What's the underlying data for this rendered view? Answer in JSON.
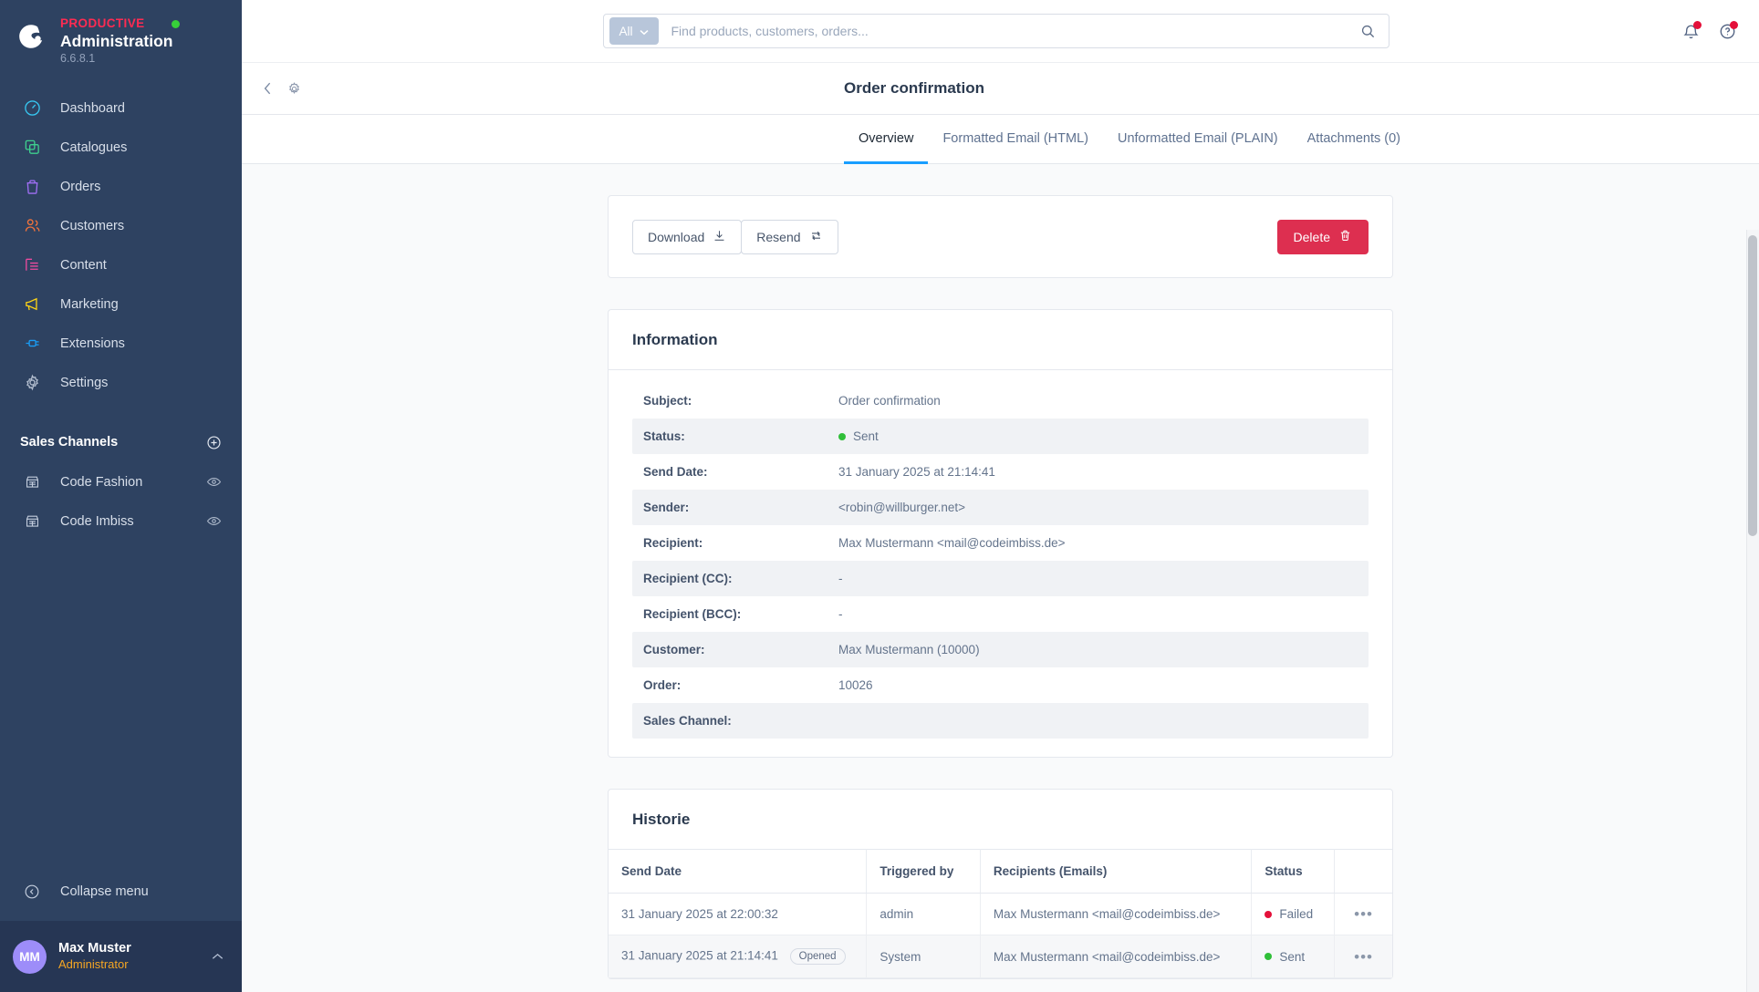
{
  "sidebar": {
    "brand": {
      "product": "PRODUCTIVE",
      "title": "Administration",
      "version": "6.6.8.1",
      "logo_icon": "shopware-logo-icon",
      "status_icon": "online-status-dot"
    },
    "items": [
      {
        "label": "Dashboard",
        "icon": "dashboard-icon",
        "color": "#37c6f0"
      },
      {
        "label": "Catalogues",
        "icon": "catalogues-icon",
        "color": "#3ecf8e"
      },
      {
        "label": "Orders",
        "icon": "orders-icon",
        "color": "#a06ff5"
      },
      {
        "label": "Customers",
        "icon": "customers-icon",
        "color": "#f2733b"
      },
      {
        "label": "Content",
        "icon": "content-icon",
        "color": "#ef4ba0"
      },
      {
        "label": "Marketing",
        "icon": "marketing-icon",
        "color": "#fbd216"
      },
      {
        "label": "Extensions",
        "icon": "extensions-icon",
        "color": "#1a9df5"
      },
      {
        "label": "Settings",
        "icon": "settings-gear-icon",
        "color": "#b4bfd0"
      }
    ],
    "sales_channels": {
      "title": "Sales Channels",
      "add_icon": "plus-circle-icon",
      "channels": [
        {
          "label": "Code Fashion",
          "icon": "storefront-icon",
          "visibility_icon": "eye-icon"
        },
        {
          "label": "Code Imbiss",
          "icon": "storefront-icon",
          "visibility_icon": "eye-icon"
        }
      ]
    },
    "collapse": {
      "label": "Collapse menu",
      "icon": "collapse-chevron-icon"
    },
    "user": {
      "initials": "MM",
      "name": "Max Muster",
      "role": "Administrator",
      "caret_icon": "chevron-up-icon"
    }
  },
  "topbar": {
    "scope_label": "All",
    "scope_caret_icon": "chevron-down-icon",
    "search_value": "",
    "search_placeholder": "Find products, customers, orders...",
    "search_icon": "search-icon",
    "notifications_icon": "bell-icon",
    "help_icon": "help-circle-icon"
  },
  "page": {
    "back_icon": "chevron-left-icon",
    "settings_icon": "gear-icon",
    "title": "Order confirmation"
  },
  "tabs": [
    {
      "label": "Overview",
      "active": true
    },
    {
      "label": "Formatted Email (HTML)",
      "active": false
    },
    {
      "label": "Unformatted Email (PLAIN)",
      "active": false
    },
    {
      "label": "Attachments (0)",
      "active": false
    }
  ],
  "actions": {
    "download": {
      "label": "Download",
      "icon": "download-icon"
    },
    "resend": {
      "label": "Resend",
      "icon": "refresh-icon"
    },
    "delete": {
      "label": "Delete",
      "icon": "trash-icon",
      "color": "#dd2f50"
    }
  },
  "information": {
    "title": "Information",
    "rows": [
      {
        "key": "Subject:",
        "value": "Order confirmation",
        "dot": null
      },
      {
        "key": "Status:",
        "value": "Sent",
        "dot": "#30bf39"
      },
      {
        "key": "Send Date:",
        "value": "31 January 2025 at 21:14:41",
        "dot": null
      },
      {
        "key": "Sender:",
        "value": "<robin@willburger.net>",
        "dot": null
      },
      {
        "key": "Recipient:",
        "value": "Max Mustermann <mail@codeimbiss.de>",
        "dot": null
      },
      {
        "key": "Recipient (CC):",
        "value": "-",
        "dot": null
      },
      {
        "key": "Recipient (BCC):",
        "value": "-",
        "dot": null
      },
      {
        "key": "Customer:",
        "value": "Max Mustermann (10000)",
        "dot": null
      },
      {
        "key": "Order:",
        "value": "10026",
        "dot": null
      },
      {
        "key": "Sales Channel:",
        "value": "",
        "dot": null
      }
    ]
  },
  "history": {
    "title": "Historie",
    "columns": [
      "Send Date",
      "Triggered by",
      "Recipients (Emails)",
      "Status",
      ""
    ],
    "rows": [
      {
        "date": "31 January 2025 at 22:00:32",
        "badge": "",
        "triggered_by": "admin",
        "recipients": "Max Mustermann <mail@codeimbiss.de>",
        "status": "Failed",
        "status_color": "#e4103a",
        "menu_icon": "ellipsis-icon"
      },
      {
        "date": "31 January 2025 at 21:14:41",
        "badge": "Opened",
        "triggered_by": "System",
        "recipients": "Max Mustermann <mail@codeimbiss.de>",
        "status": "Sent",
        "status_color": "#30bf39",
        "menu_icon": "ellipsis-icon"
      }
    ]
  }
}
